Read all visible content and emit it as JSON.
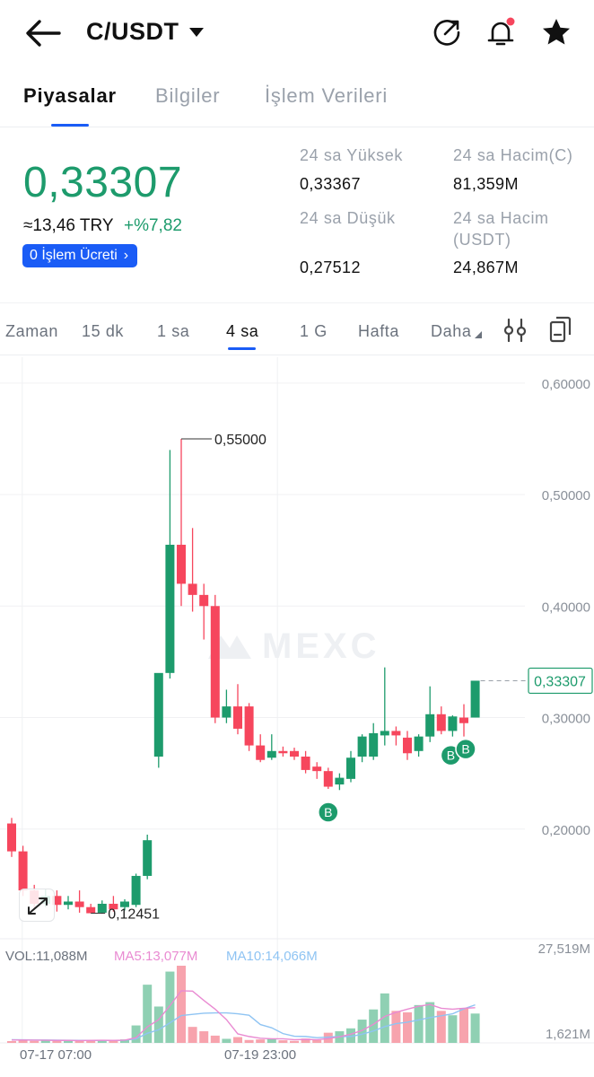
{
  "header": {
    "pair": "C/USDT",
    "icons": [
      "back-arrow-icon",
      "caret-down-icon",
      "share-icon",
      "bell-icon",
      "star-icon"
    ],
    "notification_dot_color": "#f6465d"
  },
  "tabs": [
    "Piyasalar",
    "Bilgiler",
    "İşlem Verileri"
  ],
  "ticker": {
    "last_price": "0,33307",
    "fiat_approx": "≈13,46 TRY",
    "change_pct": "+%7,82",
    "fee_badge": "0 İşlem Ücreti",
    "high_label": "24 sa Yüksek",
    "high_value": "0,33367",
    "low_label": "24 sa Düşük",
    "low_value": "0,27512",
    "vol_c_label": "24 sa Hacim(C)",
    "vol_c_value": "81,359M",
    "vol_usdt_label": "24 sa Hacim\n(USDT)",
    "vol_usdt_value": "24,867M"
  },
  "intervals": {
    "items": [
      "Zaman",
      "15 dk",
      "1 sa",
      "4 sa",
      "1 G",
      "Hafta",
      "Daha"
    ],
    "active": "4 sa"
  },
  "colors": {
    "up": "#1d9b6c",
    "down": "#f6465d",
    "accent": "#1a5cf6"
  },
  "chart_data": {
    "type": "candlestick",
    "interval": "4 sa",
    "price_axis_labels": [
      "0,60000",
      "0,50000",
      "0,40000",
      "0,30000",
      "0,20000"
    ],
    "price_axis_values": [
      0.6,
      0.5,
      0.4,
      0.3,
      0.2
    ],
    "ylim": [
      0.1016,
      0.6232
    ],
    "current_price": 0.33307,
    "current_price_label": "0,33307",
    "high_marker": {
      "value": 0.55,
      "label": "0,55000"
    },
    "low_marker": {
      "value": 0.12451,
      "label": "0,12451"
    },
    "watermark": "MEXC",
    "candles": [
      {
        "o": 0.205,
        "h": 0.21,
        "c": 0.18,
        "l": 0.175
      },
      {
        "o": 0.18,
        "h": 0.185,
        "c": 0.145,
        "l": 0.14
      },
      {
        "o": 0.145,
        "h": 0.15,
        "c": 0.133,
        "l": 0.128
      },
      {
        "o": 0.133,
        "h": 0.146,
        "c": 0.14,
        "l": 0.13
      },
      {
        "o": 0.14,
        "h": 0.145,
        "c": 0.132,
        "l": 0.126
      },
      {
        "o": 0.132,
        "h": 0.14,
        "c": 0.135,
        "l": 0.128
      },
      {
        "o": 0.135,
        "h": 0.145,
        "c": 0.13,
        "l": 0.125
      },
      {
        "o": 0.13,
        "h": 0.133,
        "c": 0.12451,
        "l": 0.12451
      },
      {
        "o": 0.125,
        "h": 0.136,
        "c": 0.133,
        "l": 0.124
      },
      {
        "o": 0.133,
        "h": 0.14,
        "c": 0.128,
        "l": 0.126
      },
      {
        "o": 0.13,
        "h": 0.137,
        "c": 0.135,
        "l": 0.127
      },
      {
        "o": 0.132,
        "h": 0.16,
        "c": 0.158,
        "l": 0.13
      },
      {
        "o": 0.158,
        "h": 0.195,
        "c": 0.19,
        "l": 0.155
      },
      {
        "o": 0.265,
        "h": 0.275,
        "c": 0.34,
        "l": 0.255
      },
      {
        "o": 0.34,
        "h": 0.54,
        "c": 0.455,
        "l": 0.335
      },
      {
        "o": 0.455,
        "h": 0.55,
        "c": 0.42,
        "l": 0.4
      },
      {
        "o": 0.42,
        "h": 0.47,
        "c": 0.41,
        "l": 0.395
      },
      {
        "o": 0.41,
        "h": 0.42,
        "c": 0.4,
        "l": 0.37
      },
      {
        "o": 0.4,
        "h": 0.41,
        "c": 0.3,
        "l": 0.295
      },
      {
        "o": 0.3,
        "h": 0.325,
        "c": 0.31,
        "l": 0.295
      },
      {
        "o": 0.31,
        "h": 0.33,
        "c": 0.29,
        "l": 0.285
      },
      {
        "o": 0.31,
        "h": 0.313,
        "c": 0.275,
        "l": 0.27
      },
      {
        "o": 0.275,
        "h": 0.285,
        "c": 0.262,
        "l": 0.26
      },
      {
        "o": 0.264,
        "h": 0.285,
        "c": 0.27,
        "l": 0.262
      },
      {
        "o": 0.27,
        "h": 0.274,
        "c": 0.268,
        "l": 0.265
      },
      {
        "o": 0.27,
        "h": 0.273,
        "c": 0.265,
        "l": 0.262
      },
      {
        "o": 0.265,
        "h": 0.27,
        "c": 0.253,
        "l": 0.25
      },
      {
        "o": 0.256,
        "h": 0.26,
        "c": 0.252,
        "l": 0.245
      },
      {
        "o": 0.252,
        "h": 0.255,
        "c": 0.238,
        "l": 0.236
      },
      {
        "o": 0.24,
        "h": 0.25,
        "c": 0.246,
        "l": 0.235
      },
      {
        "o": 0.245,
        "h": 0.27,
        "c": 0.264,
        "l": 0.242
      },
      {
        "o": 0.265,
        "h": 0.285,
        "c": 0.283,
        "l": 0.26
      },
      {
        "o": 0.265,
        "h": 0.295,
        "c": 0.286,
        "l": 0.262
      },
      {
        "o": 0.284,
        "h": 0.345,
        "c": 0.288,
        "l": 0.275
      },
      {
        "o": 0.288,
        "h": 0.292,
        "c": 0.284,
        "l": 0.275
      },
      {
        "o": 0.282,
        "h": 0.288,
        "c": 0.268,
        "l": 0.262
      },
      {
        "o": 0.27,
        "h": 0.285,
        "c": 0.283,
        "l": 0.265
      },
      {
        "o": 0.283,
        "h": 0.328,
        "c": 0.303,
        "l": 0.278
      },
      {
        "o": 0.303,
        "h": 0.31,
        "c": 0.288,
        "l": 0.285
      },
      {
        "o": 0.288,
        "h": 0.302,
        "c": 0.301,
        "l": 0.283
      },
      {
        "o": 0.3,
        "h": 0.312,
        "c": 0.295,
        "l": 0.283
      },
      {
        "o": 0.3,
        "h": 0.333,
        "c": 0.33307,
        "l": 0.3
      }
    ],
    "buy_markers": [
      {
        "index": 28,
        "label": "B"
      },
      {
        "index": 39,
        "label": "B"
      },
      {
        "index": 40,
        "label": "B"
      }
    ],
    "volume": {
      "vol_label": "VOL:11,088M",
      "ma5_label": "MA5:13,077M",
      "ma10_label": "MA10:14,066M",
      "axis_max_label": "27,519M",
      "axis_min_label": "1,621M",
      "axis_max": 27.519,
      "axis_min": 1.621,
      "ma5_color": "#e98bd2",
      "ma10_color": "#8fc4f3",
      "values": [
        1.621,
        1.8,
        1.7,
        2.1,
        1.9,
        1.65,
        1.8,
        2.0,
        1.7,
        1.8,
        2.2,
        7.0,
        21.0,
        13.5,
        25.5,
        27.519,
        6.5,
        5.0,
        3.5,
        2.4,
        3.0,
        2.0,
        2.2,
        2.5,
        1.9,
        1.7,
        2.5,
        2.0,
        4.5,
        5.0,
        6.0,
        9.0,
        12.5,
        18.0,
        12.0,
        11.5,
        14.0,
        15.0,
        12.0,
        10.5,
        13.0,
        11.088
      ],
      "ma5": [
        2.0,
        2.0,
        1.95,
        1.9,
        1.85,
        1.85,
        1.8,
        1.85,
        1.9,
        1.85,
        1.95,
        2.8,
        6.5,
        9.0,
        13.8,
        18.9,
        18.8,
        15.6,
        12.6,
        9.0,
        4.1,
        3.2,
        2.6,
        2.4,
        2.4,
        2.1,
        2.2,
        2.1,
        2.5,
        3.1,
        4.0,
        5.3,
        7.4,
        10.1,
        11.5,
        12.6,
        13.6,
        14.2,
        12.9,
        12.6,
        12.9,
        13.077
      ],
      "ma10": [
        2.1,
        2.05,
        2.0,
        2.0,
        1.95,
        1.9,
        1.85,
        1.85,
        1.85,
        1.85,
        1.9,
        2.4,
        4.3,
        5.5,
        7.9,
        10.4,
        10.8,
        11.2,
        11.3,
        11.3,
        11.0,
        10.5,
        7.3,
        6.2,
        4.2,
        3.3,
        3.2,
        2.8,
        3.0,
        3.2,
        3.2,
        4.0,
        5.1,
        6.6,
        7.6,
        8.1,
        8.9,
        9.7,
        10.3,
        11.0,
        12.7,
        14.066
      ]
    },
    "x_tick_labels": [
      {
        "index": 3,
        "label": "07-17 07:00"
      },
      {
        "index": 17,
        "label": "07-19 23:00"
      }
    ]
  }
}
